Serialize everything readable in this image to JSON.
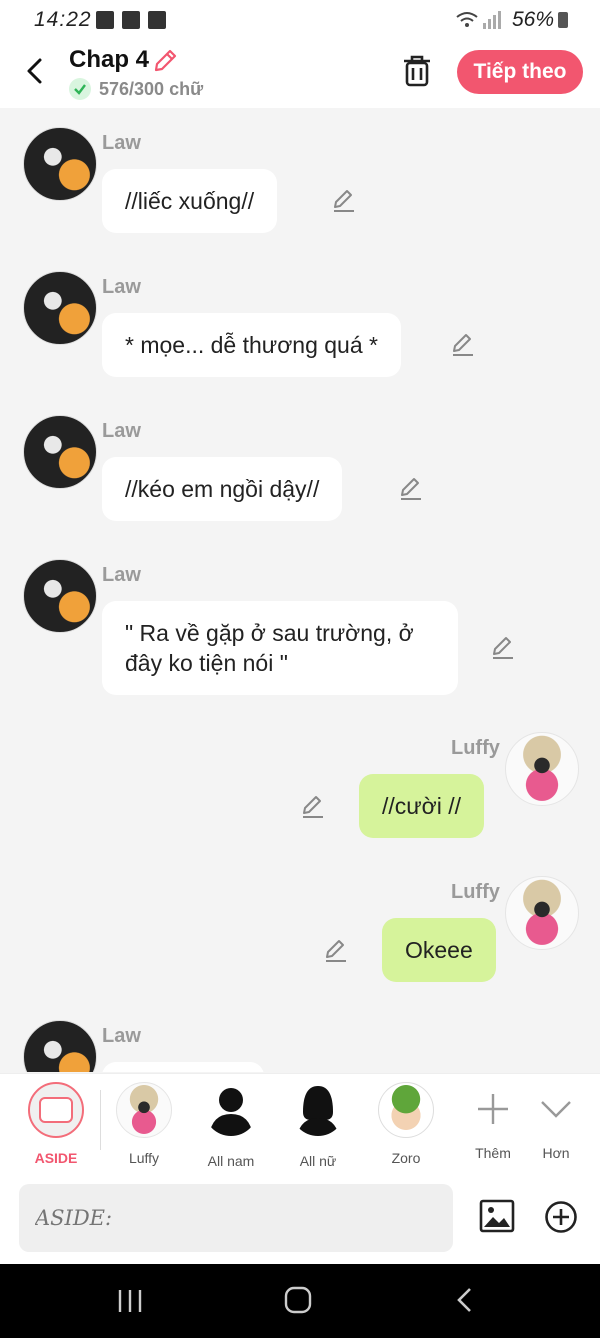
{
  "status": {
    "time": "14:22",
    "battery": "56%"
  },
  "header": {
    "title": "Chap 4",
    "word_count": "576/300 chữ",
    "next_label": "Tiếp theo"
  },
  "messages": [
    {
      "sender": "Law",
      "text": "//liếc xuống//"
    },
    {
      "sender": "Law",
      "text": "* mọe... dễ thương quá *"
    },
    {
      "sender": "Law",
      "text": "//kéo em ngồi dậy//"
    },
    {
      "sender": "Law",
      "text": "\" Ra về gặp ở sau trường, ở đây ko tiện nói \""
    },
    {
      "sender": "Luffy",
      "text": "//cười //"
    },
    {
      "sender": "Luffy",
      "text": "Okeee"
    },
    {
      "sender": "Law",
      "text": ""
    }
  ],
  "characters": [
    {
      "label": "ASIDE"
    },
    {
      "label": "Luffy"
    },
    {
      "label": "All nam"
    },
    {
      "label": "All nữ"
    },
    {
      "label": "Zoro"
    },
    {
      "label": "Thêm"
    },
    {
      "label": "Hơn"
    }
  ],
  "composer": {
    "placeholder": "ASIDE:"
  },
  "colors": {
    "accent": "#f2566f",
    "own_bubble": "#d6f39b",
    "aside_border": "#f36d7a"
  }
}
